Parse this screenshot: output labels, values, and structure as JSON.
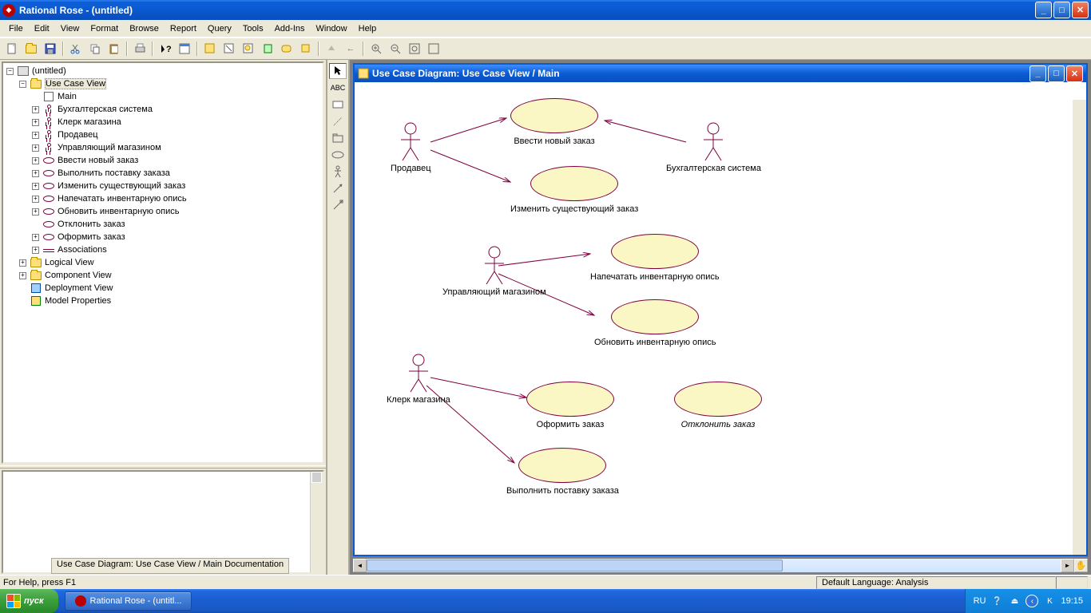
{
  "app_title": "Rational Rose - (untitled)",
  "menubar": [
    "File",
    "Edit",
    "View",
    "Format",
    "Browse",
    "Report",
    "Query",
    "Tools",
    "Add-Ins",
    "Window",
    "Help"
  ],
  "tree": {
    "root": "(untitled)",
    "use_case_view": "Use Case View",
    "main": "Main",
    "actors": [
      "Бухгалтерская система",
      "Клерк магазина",
      "Продавец",
      "Управляющий магазином"
    ],
    "usecases": [
      "Ввести новый заказ",
      "Выполнить поставку заказа",
      "Изменить существующий заказ",
      "Напечатать инвентарную опись",
      "Обновить инвентарную опись",
      "Отклонить заказ",
      "Оформить заказ"
    ],
    "associations": "Associations",
    "logical_view": "Logical View",
    "component_view": "Component View",
    "deployment_view": "Deployment View",
    "model_properties": "Model Properties"
  },
  "diagram": {
    "title": "Use Case Diagram: Use Case View / Main",
    "actors": {
      "seller": "Продавец",
      "accounting": "Бухгалтерская система",
      "manager": "Управляющий магазином",
      "clerk": "Клерк магазина"
    },
    "usecases": {
      "uc1": "Ввести новый заказ",
      "uc2": "Изменить существующий заказ",
      "uc3": "Напечатать инвентарную опись",
      "uc4": "Обновить инвентарную опись",
      "uc5": "Оформить заказ",
      "uc6": "Отклонить заказ",
      "uc7": "Выполнить поставку заказа"
    }
  },
  "doc_tab": "Use Case Diagram: Use Case View / Main Documentation",
  "status": {
    "help": "For Help, press F1",
    "lang": "Default Language: Analysis"
  },
  "taskbar": {
    "start": "пуск",
    "task": "Rational Rose - (untitl...",
    "lang": "RU",
    "time": "19:15"
  },
  "palette_text": "ABC"
}
